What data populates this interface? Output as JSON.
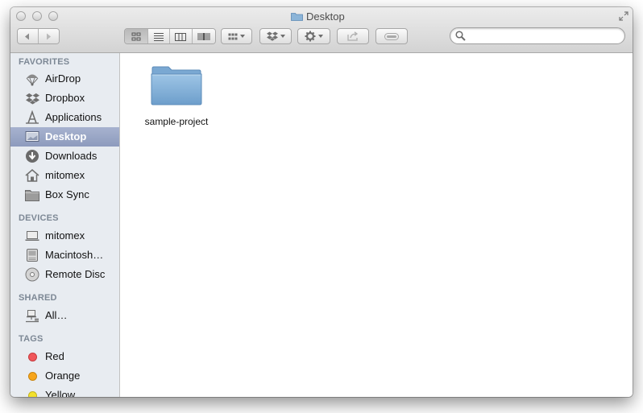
{
  "window": {
    "title": "Desktop"
  },
  "toolbar": {
    "nav": {
      "back": "back-icon",
      "forward": "forward-icon"
    },
    "view_modes": [
      "icon-view-icon",
      "list-view-icon",
      "column-view-icon",
      "cover-flow-icon"
    ],
    "active_view": "icon-view",
    "arrange_icon": "arrange-icon",
    "dropbox_icon": "dropbox-icon",
    "action_icon": "gear-icon",
    "share_icon": "share-icon",
    "tags_icon": "tag-icon",
    "search": {
      "value": "",
      "placeholder": ""
    }
  },
  "sidebar": {
    "favorites": {
      "header": "FAVORITES",
      "items": [
        {
          "label": "AirDrop",
          "icon": "airdrop-icon"
        },
        {
          "label": "Dropbox",
          "icon": "dropbox-icon"
        },
        {
          "label": "Applications",
          "icon": "applications-icon"
        },
        {
          "label": "Desktop",
          "icon": "desktop-icon",
          "selected": true
        },
        {
          "label": "Downloads",
          "icon": "downloads-icon"
        },
        {
          "label": "mitomex",
          "icon": "home-icon"
        },
        {
          "label": "Box Sync",
          "icon": "folder-icon"
        }
      ]
    },
    "devices": {
      "header": "DEVICES",
      "items": [
        {
          "label": "mitomex",
          "icon": "laptop-icon"
        },
        {
          "label": "Macintosh…",
          "icon": "hard-drive-icon"
        },
        {
          "label": "Remote Disc",
          "icon": "disc-icon"
        }
      ]
    },
    "shared": {
      "header": "SHARED",
      "items": [
        {
          "label": "All…",
          "icon": "network-icon"
        }
      ]
    },
    "tags": {
      "header": "TAGS",
      "items": [
        {
          "label": "Red",
          "color": "#f0565a"
        },
        {
          "label": "Orange",
          "color": "#f7a51b"
        },
        {
          "label": "Yellow",
          "color": "#f3e12c"
        }
      ]
    }
  },
  "content": {
    "items": [
      {
        "label": "sample-project",
        "icon": "folder-icon"
      }
    ]
  },
  "colors": {
    "selection": "#9aa6c6",
    "sidebar_bg": "#e8ecf1",
    "folder_blue": "#86b3da"
  }
}
